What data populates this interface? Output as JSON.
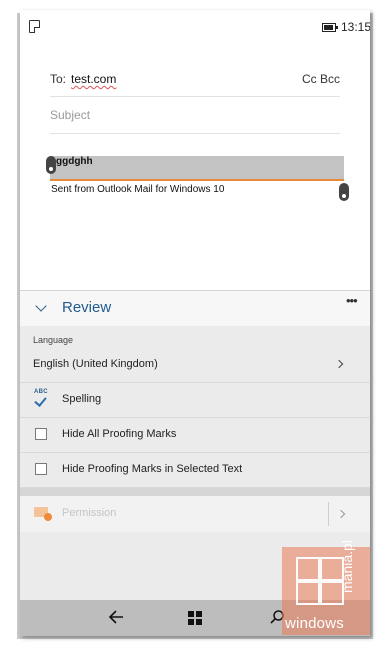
{
  "status_bar": {
    "time": "13:15",
    "icons": [
      "note-icon",
      "battery-icon"
    ]
  },
  "compose": {
    "to_label": "To:",
    "to_value": "test.com",
    "cc_bcc_label": "Cc Bcc",
    "subject_placeholder": "Subject",
    "subject_value": "",
    "body_selected_text": "ggdghh",
    "signature": "Sent from Outlook Mail for Windows 10"
  },
  "review_pane": {
    "title": "Review",
    "more_label": "•••",
    "language_section_label": "Language",
    "language_value": "English (United Kingdom)",
    "spelling_icon_text": "ABC",
    "spelling_label": "Spelling",
    "hide_all_proofing_label": "Hide All Proofing Marks",
    "hide_all_proofing_checked": false,
    "hide_selected_proofing_label": "Hide Proofing Marks in Selected Text",
    "hide_selected_proofing_checked": false,
    "permission_label": "Permission",
    "permission_enabled": false
  },
  "navbar": {
    "icons": [
      "back-arrow-icon",
      "windows-logo-icon",
      "search-icon"
    ]
  },
  "watermark": {
    "text_main": "windows",
    "text_vertical": "mania.pl"
  },
  "colors": {
    "accent": "#1f5b8e",
    "selection_underline": "#e88a3c",
    "pane_background": "#ebebeb",
    "navbar_background": "#bdbdbd",
    "watermark": "#e97a56"
  }
}
